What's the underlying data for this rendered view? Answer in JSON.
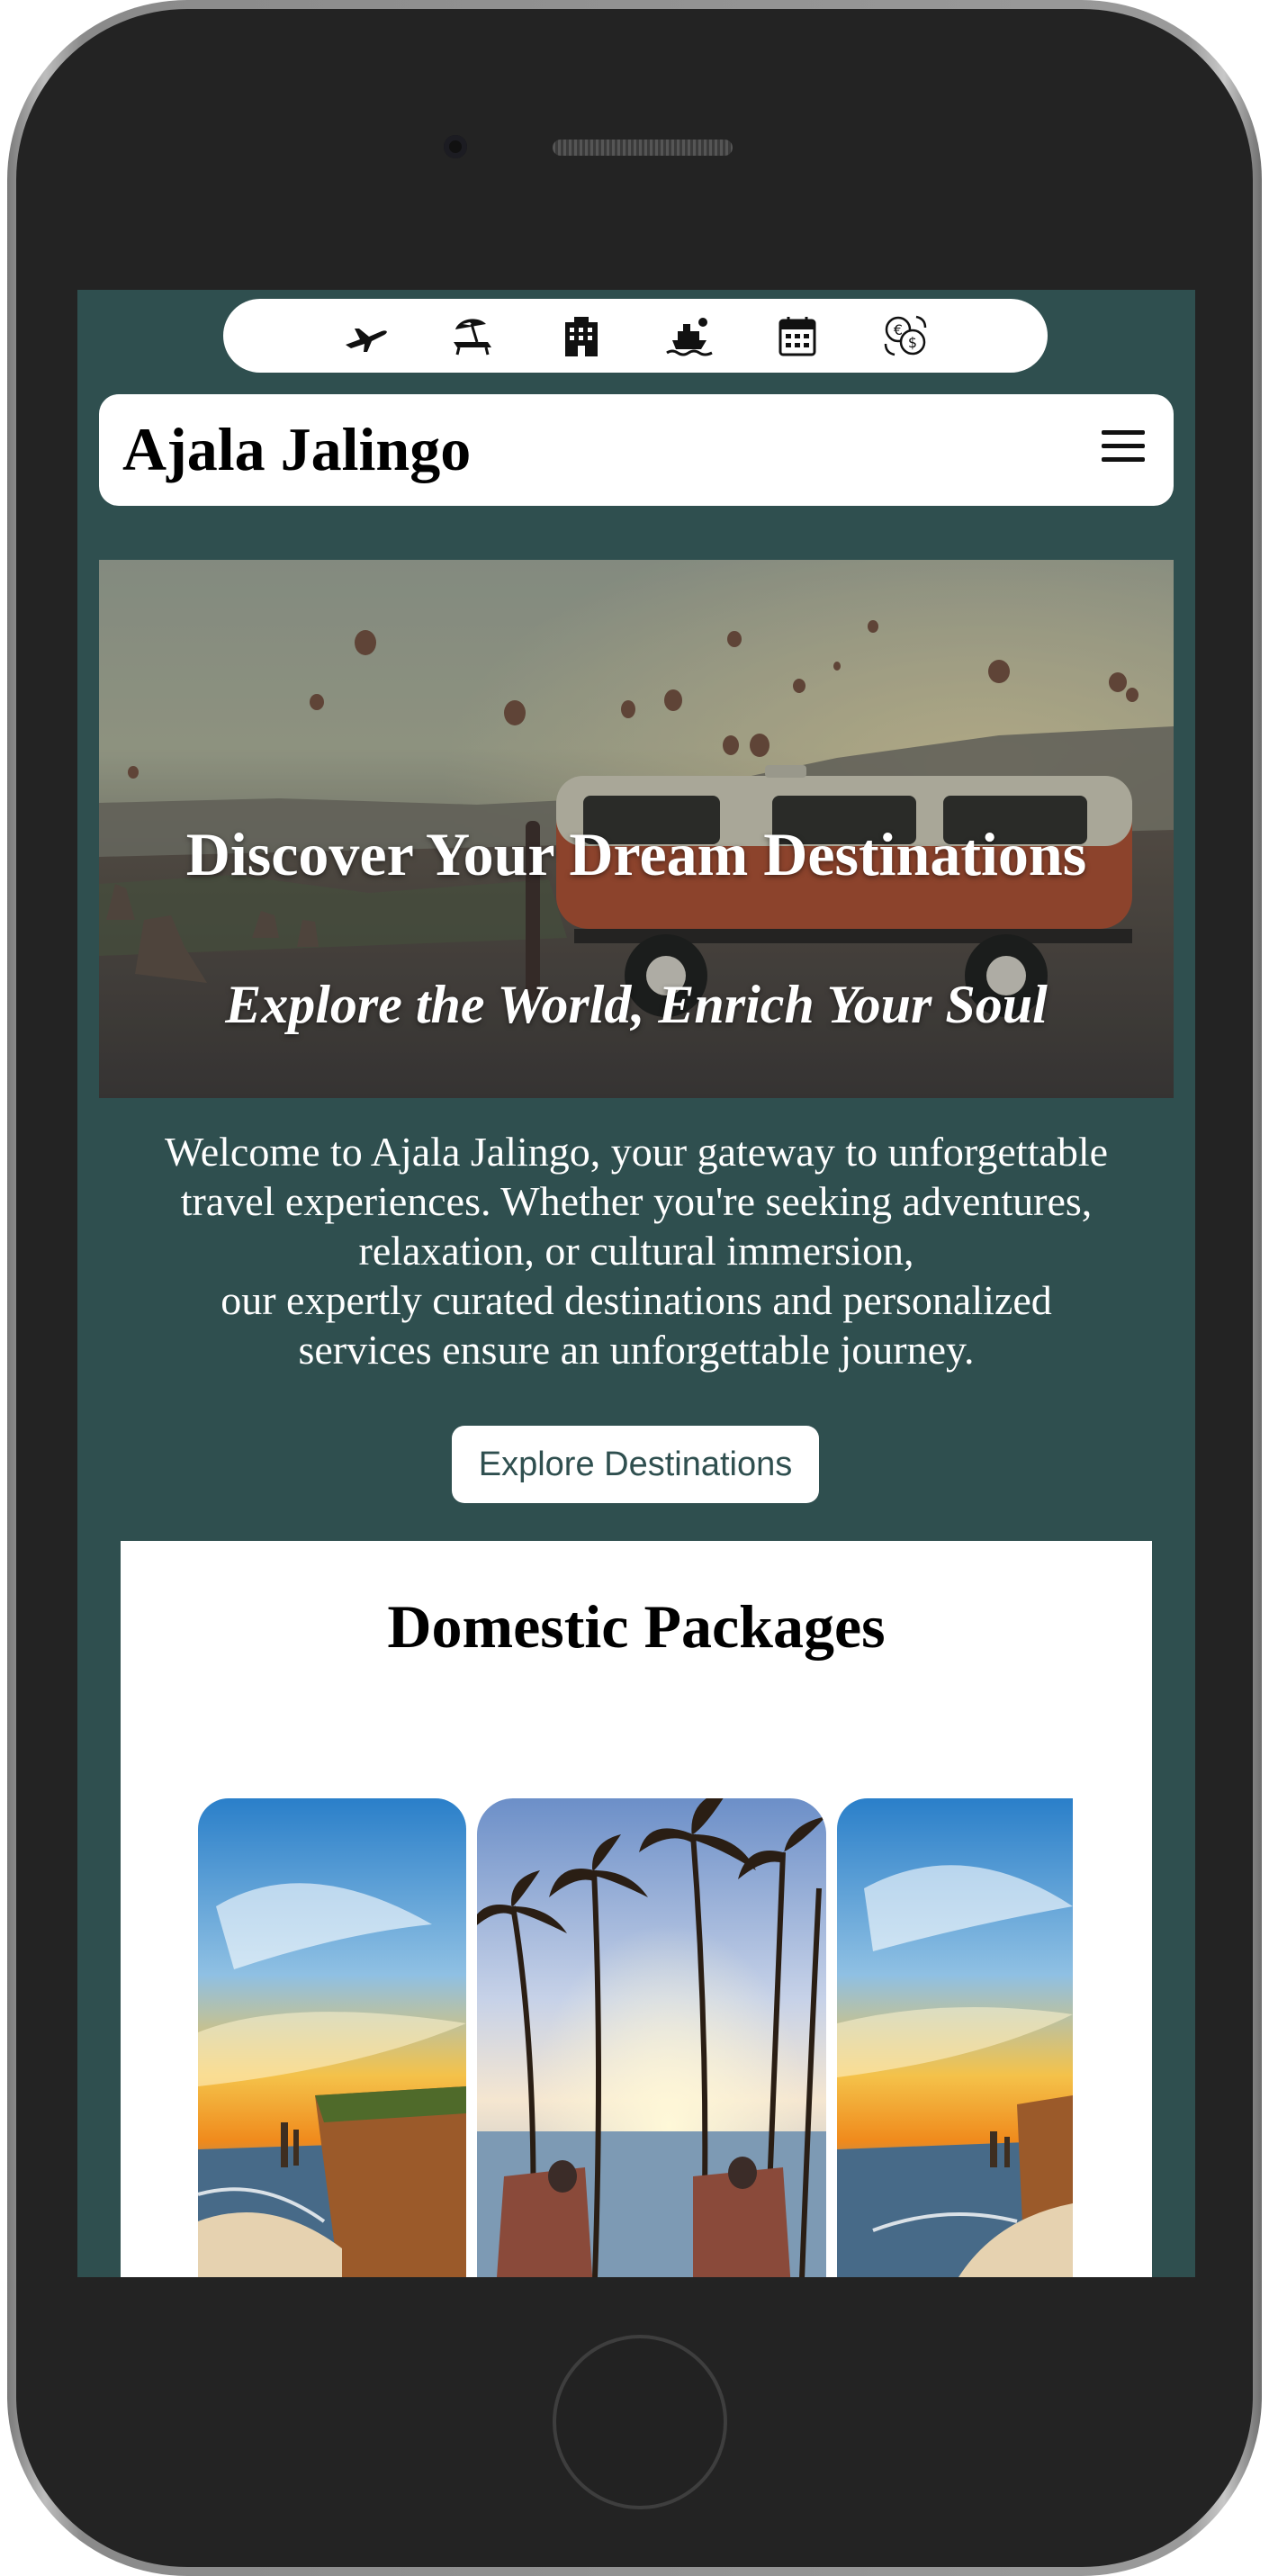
{
  "iconbar": {
    "icons": [
      "airplane-icon",
      "beach-umbrella-icon",
      "hotel-icon",
      "cruise-ship-icon",
      "calendar-icon",
      "currency-exchange-icon"
    ]
  },
  "navbar": {
    "brand": "Ajala Jalingo",
    "menu_icon": "hamburger-menu-icon"
  },
  "hero": {
    "title": "Discover Your Dream Destinations",
    "subtitle": "Explore the World, Enrich Your Soul"
  },
  "welcome": {
    "lines": [
      "Welcome to Ajala Jalingo, your gateway to unforgettable",
      "travel experiences. Whether you're seeking adventures,",
      "relaxation, or cultural immersion,",
      "our expertly curated destinations and personalized",
      "services ensure an unforgettable journey."
    ]
  },
  "cta": {
    "label": "Explore Destinations"
  },
  "packages": {
    "title": "Domestic Packages"
  },
  "colors": {
    "background": "#2f4f4f",
    "card": "#ffffff",
    "button_text": "#2f4f4f"
  }
}
